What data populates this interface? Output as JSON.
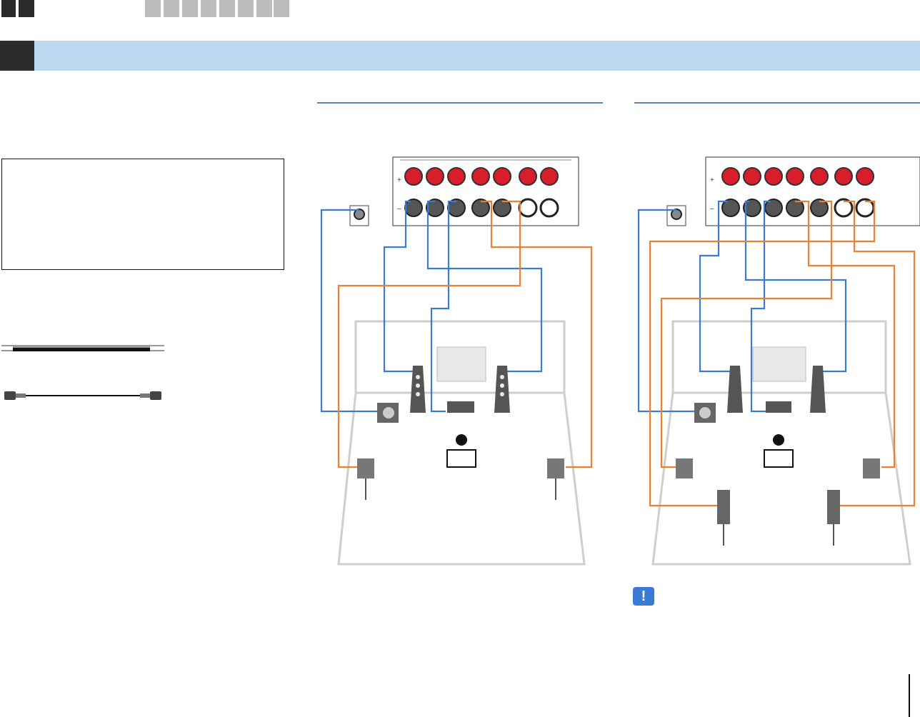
{
  "nav": {
    "tabs_dark": 2,
    "tabs_gray": 8
  },
  "diagrams": {
    "wire_colors": {
      "front": "#3a7bd5",
      "surround": "#f08030"
    },
    "amp_terminal_red": "#d81e2b"
  },
  "icons": {
    "caution": "exclamation-icon",
    "caution_symbol": "!"
  }
}
